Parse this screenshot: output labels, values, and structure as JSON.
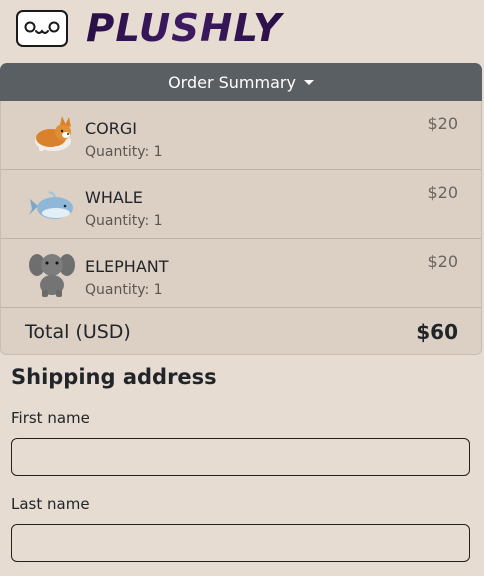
{
  "brand": {
    "name": "PLUSHLY",
    "logo_icon": "cat-face-icon"
  },
  "order_summary": {
    "toggle_label": "Order Summary",
    "toggle_icon": "caret-down-icon",
    "items": [
      {
        "name": "CORGI",
        "quantity": "Quantity: 1",
        "price": "$20",
        "thumb_icon": "corgi-plush-icon"
      },
      {
        "name": "WHALE",
        "quantity": "Quantity: 1",
        "price": "$20",
        "thumb_icon": "whale-plush-icon"
      },
      {
        "name": "ELEPHANT",
        "quantity": "Quantity: 1",
        "price": "$20",
        "thumb_icon": "elephant-plush-icon"
      }
    ],
    "total_label": "Total (USD)",
    "total_amount": "$60"
  },
  "shipping": {
    "title": "Shipping address",
    "first_name_label": "First name",
    "first_name_value": "",
    "last_name_label": "Last name",
    "last_name_value": ""
  },
  "colors": {
    "page_background": "#e6dcd2",
    "toggle_background": "#5a5f64",
    "logo_purple": "#3a1a5a"
  }
}
